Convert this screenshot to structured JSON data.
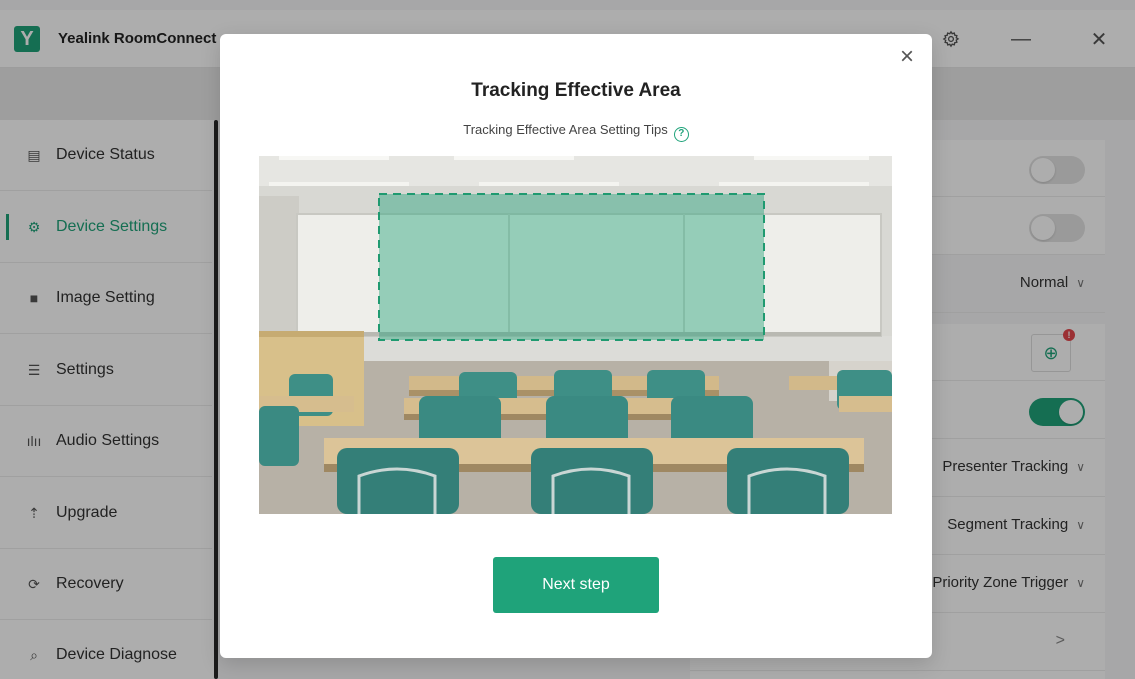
{
  "app": {
    "title": "Yealink RoomConnect",
    "logo_letter": "Y",
    "accent": "#1fa37a"
  },
  "window_controls": {
    "settings_icon": "gear-icon",
    "minimize": "—",
    "close": "✕"
  },
  "sidebar": {
    "items": [
      {
        "label": "Device Status",
        "icon": "document-icon",
        "glyph": "▤"
      },
      {
        "label": "Device Settings",
        "icon": "device-settings-icon",
        "glyph": "⚙",
        "active": true
      },
      {
        "label": "Image Setting",
        "icon": "camera-icon",
        "glyph": "■"
      },
      {
        "label": "Settings",
        "icon": "sliders-icon",
        "glyph": "☰"
      },
      {
        "label": "Audio Settings",
        "icon": "audio-wave-icon",
        "glyph": "ılıı"
      },
      {
        "label": "Upgrade",
        "icon": "upgrade-icon",
        "glyph": "⇡"
      },
      {
        "label": "Recovery",
        "icon": "recovery-icon",
        "glyph": "⟳"
      },
      {
        "label": "Device Diagnose",
        "icon": "diagnose-icon",
        "glyph": "⌕"
      }
    ]
  },
  "settings_rows": {
    "mode_value": "Normal",
    "tracking_mode": "Presenter Tracking",
    "tracking_type": "Segment Tracking",
    "trigger": "Priority Zone Trigger",
    "toggle1": false,
    "toggle2": false,
    "toggle3": true,
    "badge": "!"
  },
  "modal": {
    "title": "Tracking Effective Area",
    "tips": "Tracking Effective Area Setting Tips",
    "help_glyph": "?",
    "close_glyph": "×",
    "next_label": "Next step"
  }
}
